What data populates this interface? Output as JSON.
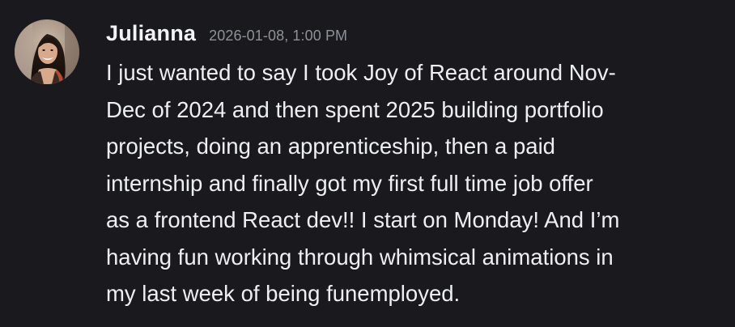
{
  "message": {
    "author": "Julianna",
    "timestamp": "2026-01-08, 1:00 PM",
    "avatar_icon": "user-avatar-photo",
    "lines": [
      "I just wanted to say I took Joy of React around Nov-",
      "Dec of 2024 and then spent 2025 building portfolio",
      "projects, doing an apprenticeship, then a paid",
      "internship and finally got my first full time job offer",
      "as a frontend React dev!! I start on Monday! And I’m",
      "having fun working through whimsical animations in",
      "my last week of being funemployed."
    ]
  },
  "colors": {
    "background": "#1a1a1e",
    "author": "#f2f3f5",
    "timestamp": "#8e9199",
    "text": "#eeeff1"
  }
}
